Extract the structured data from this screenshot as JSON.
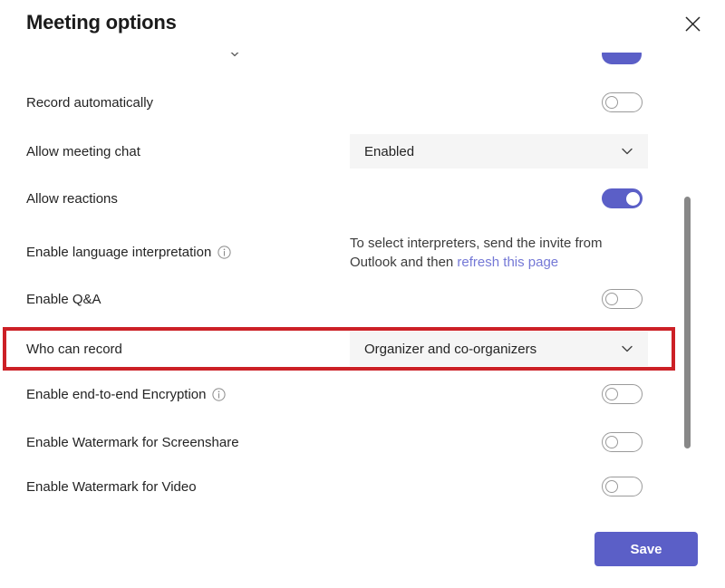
{
  "dialog": {
    "title": "Meeting options",
    "close_label": "Close",
    "close_icon": "close-icon"
  },
  "scroll": {
    "position_percent": 40
  },
  "colors": {
    "accent": "#5b5fc7",
    "link": "#7478d6",
    "highlight": "#cc2026",
    "dropdown_bg": "#f5f5f5",
    "toggle_off_border": "#9a9a9a",
    "scrollbar": "#888888"
  },
  "clipped_row": {
    "chevron_icon": "chevron-down-icon",
    "toggle_state": "on"
  },
  "rows": [
    {
      "key": "record-automatically",
      "label": "Record automatically",
      "control": "toggle",
      "state": "off",
      "has_info_icon": false,
      "highlighted": false
    },
    {
      "key": "allow-meeting-chat",
      "label": "Allow meeting chat",
      "control": "dropdown",
      "value": "Enabled",
      "chevron_icon": "chevron-down-icon",
      "has_info_icon": false,
      "highlighted": false
    },
    {
      "key": "allow-reactions",
      "label": "Allow reactions",
      "control": "toggle",
      "state": "on",
      "has_info_icon": false,
      "highlighted": false
    },
    {
      "key": "enable-language-interpretation",
      "label": "Enable language interpretation",
      "control": "note",
      "has_info_icon": true,
      "info_icon": "info-icon",
      "note_text_before": "To select interpreters, send the invite from Outlook and then ",
      "note_link": "refresh this page",
      "highlighted": false
    },
    {
      "key": "enable-qa",
      "label": "Enable Q&A",
      "control": "toggle",
      "state": "off",
      "has_info_icon": false,
      "highlighted": false
    },
    {
      "key": "who-can-record",
      "label": "Who can record",
      "control": "dropdown",
      "value": "Organizer and co-organizers",
      "chevron_icon": "chevron-down-icon",
      "has_info_icon": false,
      "highlighted": true
    },
    {
      "key": "enable-end-to-end-encryption",
      "label": "Enable end-to-end Encryption",
      "control": "toggle",
      "state": "off",
      "has_info_icon": true,
      "info_icon": "info-icon",
      "highlighted": false
    },
    {
      "key": "enable-watermark-for-screenshare",
      "label": "Enable Watermark for Screenshare",
      "control": "toggle",
      "state": "off",
      "has_info_icon": false,
      "highlighted": false
    },
    {
      "key": "enable-watermark-for-video",
      "label": "Enable Watermark for Video",
      "control": "toggle",
      "state": "off",
      "has_info_icon": false,
      "highlighted": false
    }
  ],
  "footer": {
    "save_label": "Save"
  }
}
